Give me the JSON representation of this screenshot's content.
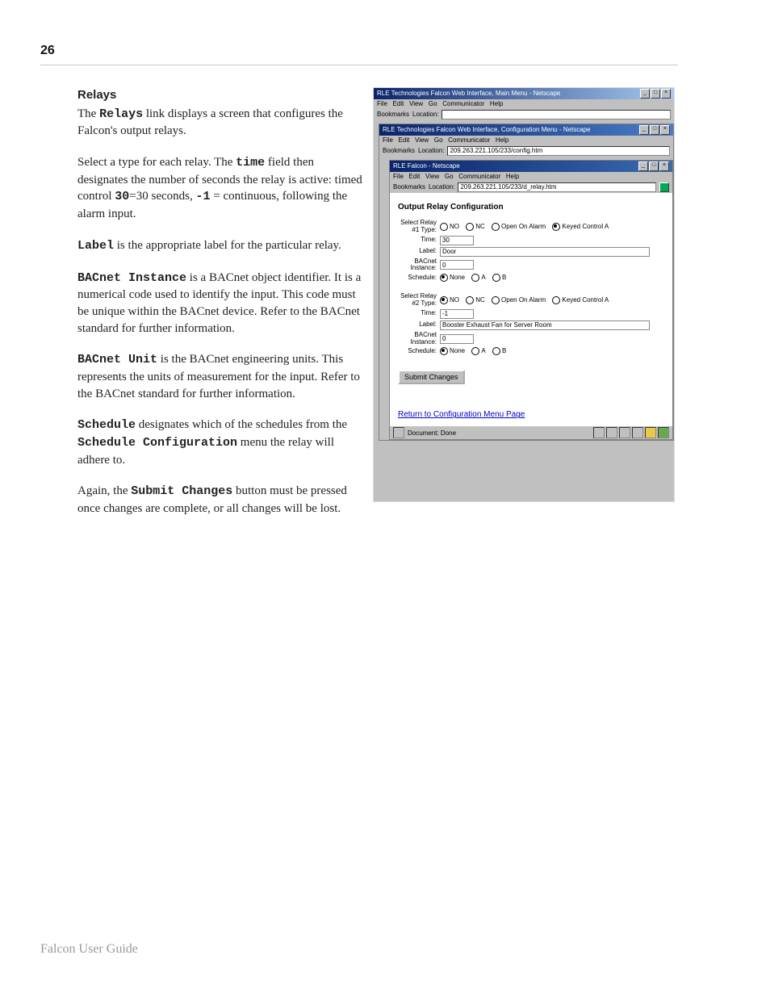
{
  "page_number": "26",
  "heading": "Relays",
  "p1a": "The ",
  "p1b": "Relays",
  "p1c": " link displays a screen that configures the Falcon's output relays.",
  "p2a": "Select a type for each relay.  The ",
  "p2b": "time",
  "p2c": " field then designates the number of seconds the relay is active: timed control ",
  "p2d": "30",
  "p2e": "=30 seconds, ",
  "p2f": "-1",
  "p2g": " = continuous, following the alarm input.",
  "p3a": "Label",
  "p3b": " is the appropriate label for the particular relay.",
  "p4a": "BACnet Instance",
  "p4b": " is a BACnet object identifier.  It is a numerical code used to identify the input.  This code must be unique within the BACnet device.  Refer to the BACnet standard for further information.",
  "p5a": "BACnet Unit",
  "p5b": " is the BACnet engineering units.  This represents the units of measurement for the input.  Refer to the BACnet standard for further information.",
  "p6a": "Schedule",
  "p6b": " designates which of the schedules from the ",
  "p6c": "Schedule Configuration",
  "p6d": " menu the relay will adhere to.",
  "p7a": "Again, the ",
  "p7b": "Submit Changes",
  "p7c": " button must be pressed once changes are complete, or all changes will be lost.",
  "footer": "Falcon User Guide",
  "windows": {
    "w1_title": "RLE Technologies Falcon Web Interface, Main Menu - Netscape",
    "w2_title": "RLE Technologies Falcon Web Interface, Configuration Menu - Netscape",
    "w3_title": "RLE Falcon - Netscape",
    "menubar": "File   Edit   View   Go   Communicator   Help",
    "bookmarks": "Bookmarks",
    "location": "Location:",
    "addr2": "209.263.221.105/233/config.htm",
    "addr3": "209.263.221.105/233/d_relay.htm"
  },
  "form": {
    "heading": "Output Relay Configuration",
    "row_label_select": "Select Relay #1 Type:",
    "row_label_select2": "Select Relay #2 Type:",
    "radios": [
      "NO",
      "NC",
      "Open On Alarm",
      "Keyed Control A"
    ],
    "time_label": "Time:",
    "time1": "30",
    "time2": "-1",
    "label_label": "Label:",
    "label1": "Door",
    "label2": "Booster Exhaust Fan for Server Room",
    "bacnet_label": "BACnet Instance:",
    "bacnet1": "0",
    "bacnet2": "0",
    "schedule_label": "Schedule:",
    "schedule_opts": [
      "None",
      "A",
      "B"
    ],
    "submit": "Submit Changes",
    "return": "Return to Configuration Menu Page"
  },
  "statusbar": {
    "doc": "Document: Done"
  }
}
